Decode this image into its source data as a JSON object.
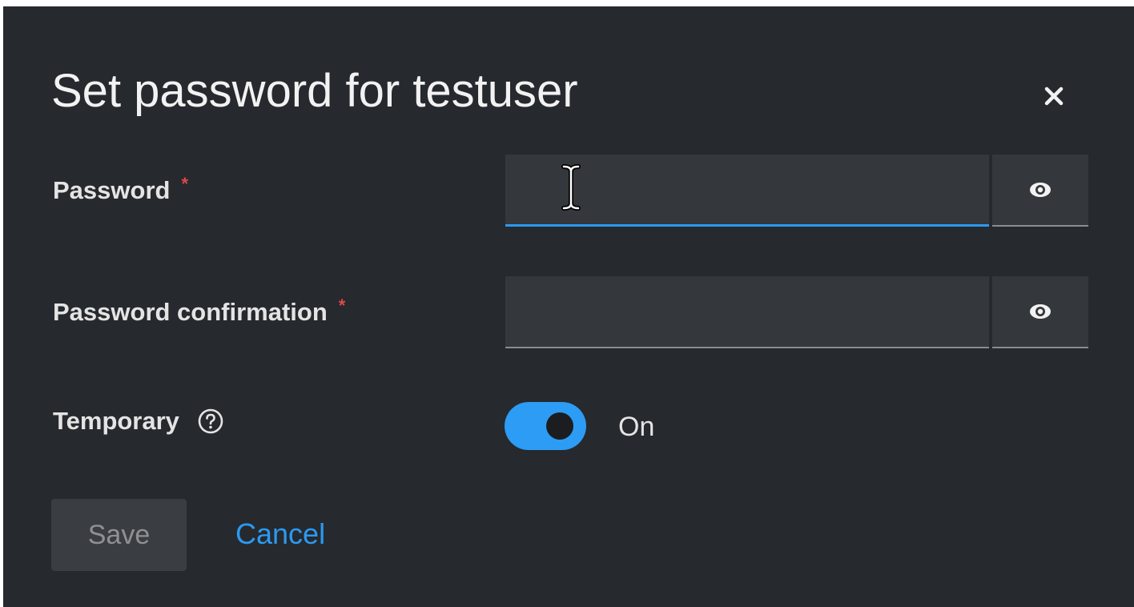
{
  "modal": {
    "title": "Set password for testuser",
    "close_icon": "close-icon"
  },
  "form": {
    "password": {
      "label": "Password",
      "required_mark": "*",
      "value": "",
      "reveal_icon": "eye-icon"
    },
    "password_confirmation": {
      "label": "Password confirmation",
      "required_mark": "*",
      "value": "",
      "reveal_icon": "eye-icon"
    },
    "temporary": {
      "label": "Temporary",
      "help_icon": "help-icon",
      "toggle_state": "On",
      "enabled": true
    }
  },
  "actions": {
    "save_label": "Save",
    "cancel_label": "Cancel"
  },
  "colors": {
    "background": "#26292d",
    "accent": "#2b9af3",
    "required": "#e0474c",
    "field_bg": "#34373b"
  }
}
